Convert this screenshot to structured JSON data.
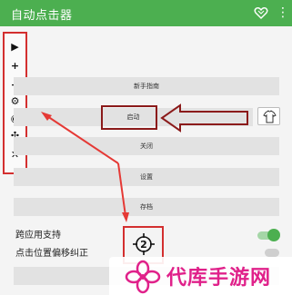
{
  "app": {
    "title": "自动点击器"
  },
  "toolbar": {
    "play": "▶",
    "add": "+",
    "remove": "−",
    "settings": "⚙",
    "hide": "◉",
    "move": "✣",
    "close": "✕"
  },
  "buttons": {
    "guide": "新手指南",
    "start": "启动",
    "stop": "关闭",
    "settings": "设置",
    "save": "存档"
  },
  "options": {
    "cross_app": "跨应用支持",
    "offset_fix": "点击位置偏移纠正",
    "cross_app_on": true,
    "offset_fix_on": false
  },
  "target": {
    "number": "2"
  },
  "watermark": {
    "text": "代库手游网"
  },
  "colors": {
    "appbar": "#4caf50",
    "annotation_red": "#d32f2f",
    "annotation_dark_red": "#8b1a1a",
    "watermark_pink": "#e0218a"
  }
}
